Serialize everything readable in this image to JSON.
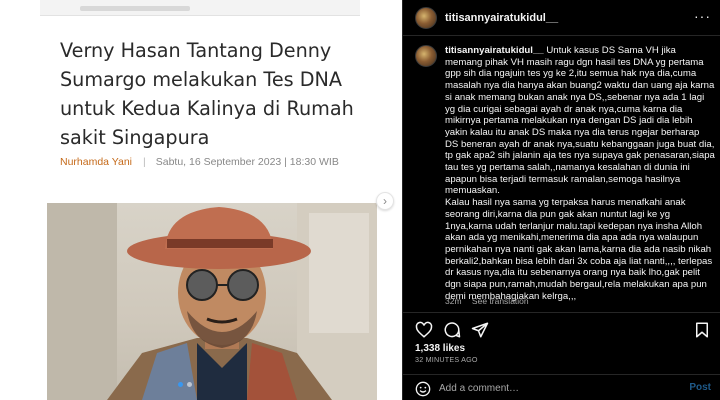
{
  "article": {
    "headline": "Verny Hasan Tantang Denny Sumargo melakukan Tes DNA untuk Kedua Kalinya di Rumah sakit Singapura",
    "author": "Nurhamda Yani",
    "date": "Sabtu, 16 September 2023 | 18:30 WIB"
  },
  "post": {
    "username": "titisannyairatukidul__",
    "caption_text": "Untuk kasus DS Sama VH jika memang pihak VH masih ragu dgn hasil tes DNA yg pertama gpp sih dia ngajuin tes yg ke 2,itu semua hak nya dia,cuma masalah nya dia hanya akan buang2 waktu dan uang aja karna si anak memang bukan anak nya DS,,sebenar nya ada 1 lagi yg dia curigai sebagai ayah dr anak nya,cuma karna dia mikirnya pertama melakukan nya dengan DS jadi dia lebih yakin kalau itu anak DS maka nya dia terus ngejar berharap DS beneran ayah dr anak nya,suatu kebanggaan juga buat dia, tp gak apa2 sih jalanin aja tes nya supaya gak penasaran,siapa tau tes yg pertama salah,,namanya kesalahan di dunia ini apapun bisa terjadi termasuk ramalan,semoga hasilnya memuaskan.",
    "caption_text_2": "Kalau hasil nya sama yg terpaksa harus menafkahi anak seorang diri,karna dia pun gak akan nuntut lagi ke yg 1nya,karna udah terlanjur malu.tapi kedepan nya insha Alloh akan ada yg menikahi,menerima dia apa ada nya walaupun pernikahan nya nanti gak akan lama,karna dia ada nasib nikah berkali2,bahkan bisa lebih dari 3x coba aja liat nanti,,,, terlepas dr kasus nya,dia itu sebenarnya orang nya baik lho,gak pelit dgn siapa pun,ramah,mudah bergaul,rela melakukan apa pun demi membahagiakan kelrga,,,",
    "caption_age": "32m",
    "see_translation": "See translation",
    "likes": "1,338 likes",
    "time_ago": "32 MINUTES AGO",
    "more": "···",
    "comment_placeholder": "Add a comment…",
    "post_label": "Post"
  },
  "icons": {
    "like": "heart-icon",
    "comment": "comment-icon",
    "share": "paper-plane-icon",
    "save": "bookmark-icon",
    "emoji": "smiley-icon"
  },
  "colors": {
    "author": "#c56a1a",
    "accent": "#3897f0",
    "post_button": "#1f5a8a"
  }
}
